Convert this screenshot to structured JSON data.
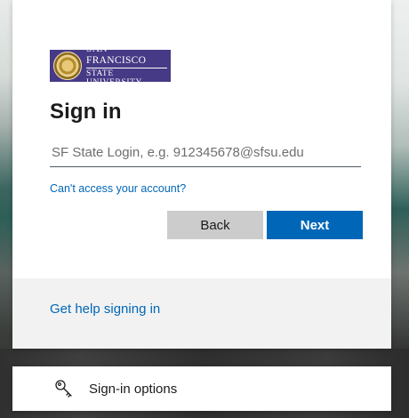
{
  "org": {
    "logo_line1": "SAN FRANCISCO",
    "logo_line2": "STATE UNIVERSITY",
    "seal_icon": "university-seal-icon"
  },
  "signin": {
    "title": "Sign in",
    "email_placeholder": "SF State Login, e.g. 912345678@sfsu.edu",
    "cant_access_link": "Can't access your account?",
    "back_label": "Back",
    "next_label": "Next"
  },
  "help": {
    "link_label": "Get help signing in"
  },
  "options": {
    "icon": "key-icon",
    "label": "Sign-in options"
  },
  "colors": {
    "accent": "#0067b8",
    "logo_bg": "#463a86",
    "back_button": "#cccccc",
    "help_strip": "#f2f2f2"
  }
}
